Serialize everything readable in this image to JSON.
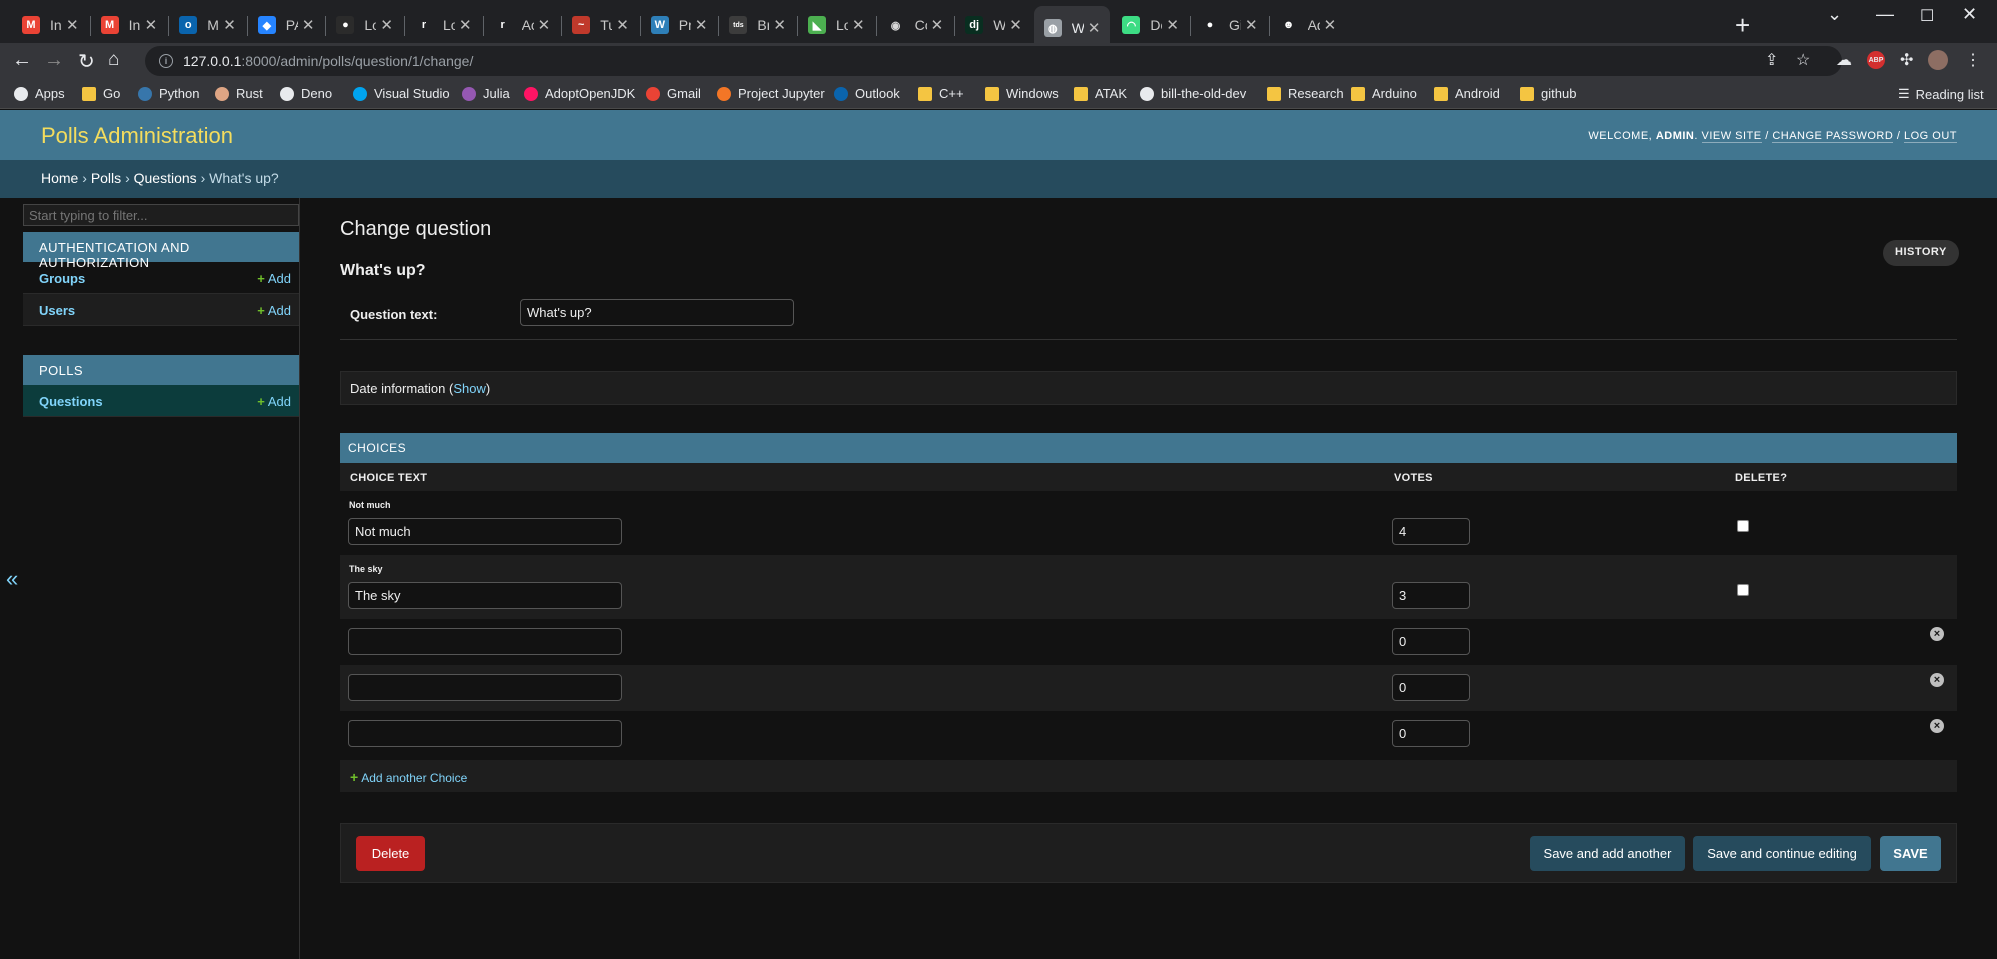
{
  "browser": {
    "tabs": [
      {
        "title": "Inbox",
        "icon": "gmail-icon",
        "color": "#ea4335",
        "glyph": "M"
      },
      {
        "title": "Inbox -",
        "icon": "gmail-icon",
        "color": "#ea4335",
        "glyph": "M"
      },
      {
        "title": "Mail - V",
        "icon": "outlook-icon",
        "color": "#0a64ad",
        "glyph": "o"
      },
      {
        "title": "PAT bo",
        "icon": "jira-icon",
        "color": "#2684ff",
        "glyph": "◆"
      },
      {
        "title": "LoRaW",
        "icon": "github-icon",
        "color": "#2b2b2b",
        "glyph": "●"
      },
      {
        "title": "LoRa",
        "icon": "readthedocs-icon",
        "color": "#ffffff",
        "glyph": "r"
      },
      {
        "title": "Accele",
        "icon": "readthedocs-icon",
        "color": "#ffffff",
        "glyph": "r"
      },
      {
        "title": "Turnin",
        "icon": "turning-icon",
        "color": "#c0392b",
        "glyph": "~"
      },
      {
        "title": "Progra",
        "icon": "wordpress-icon",
        "color": "#2e7fb8",
        "glyph": "W"
      },
      {
        "title": "Bring y",
        "icon": "tds-icon",
        "color": "#3c3c3c",
        "glyph": "tds"
      },
      {
        "title": "Long R",
        "icon": "longr-icon",
        "color": "#4caf50",
        "glyph": "◣"
      },
      {
        "title": "Config",
        "icon": "linux-icon",
        "color": "#d7d7d7",
        "glyph": "◉"
      },
      {
        "title": "Writing",
        "icon": "django-icon",
        "color": "#092e20",
        "glyph": "dj"
      },
      {
        "title": "What's",
        "icon": "globe-icon",
        "color": "#9aa0a6",
        "glyph": "◍",
        "active": true
      },
      {
        "title": "Downl",
        "icon": "android-icon",
        "color": "#3ddc84",
        "glyph": "◠"
      },
      {
        "title": "GitHub",
        "icon": "github-icon",
        "color": "#ffffff",
        "glyph": "●"
      },
      {
        "title": "Add No",
        "icon": "ghost-icon",
        "color": "#ffffff",
        "glyph": "☻"
      }
    ],
    "url_host": "127.0.0.1",
    "url_path": ":8000/admin/polls/question/1/change/",
    "bookmarks": [
      {
        "label": "Apps",
        "icon": "apps-grid-icon"
      },
      {
        "label": "Go",
        "icon": "folder-icon"
      },
      {
        "label": "Python",
        "icon": "python-icon"
      },
      {
        "label": "Rust",
        "icon": "rust-icon"
      },
      {
        "label": "Deno",
        "icon": "deno-icon"
      },
      {
        "label": "Visual Studio",
        "icon": "windows-icon"
      },
      {
        "label": "Julia",
        "icon": "julia-icon"
      },
      {
        "label": "AdoptOpenJDK",
        "icon": "adoptopenjdk-icon"
      },
      {
        "label": "Gmail",
        "icon": "gmail-icon"
      },
      {
        "label": "Project Jupyter",
        "icon": "jupyter-icon"
      },
      {
        "label": "Outlook",
        "icon": "outlook-icon"
      },
      {
        "label": "C++",
        "icon": "folder-icon"
      },
      {
        "label": "Windows",
        "icon": "folder-icon"
      },
      {
        "label": "ATAK",
        "icon": "folder-icon"
      },
      {
        "label": "bill-the-old-dev",
        "icon": "github-icon"
      },
      {
        "label": "Research",
        "icon": "folder-icon"
      },
      {
        "label": "Arduino",
        "icon": "folder-icon"
      },
      {
        "label": "Android",
        "icon": "folder-icon"
      },
      {
        "label": "github",
        "icon": "folder-icon"
      }
    ],
    "reading_list": "Reading list"
  },
  "header": {
    "branding": "Polls Administration",
    "welcome": "WELCOME,",
    "username": "ADMIN",
    "period": ".",
    "view_site": "VIEW SITE",
    "change_password": "CHANGE PASSWORD",
    "log_out": "LOG OUT",
    "sep": "/"
  },
  "breadcrumbs": {
    "home": "Home",
    "app": "Polls",
    "model": "Questions",
    "current": "What's up?",
    "sep": "›"
  },
  "sidebar": {
    "filter_placeholder": "Start typing to filter...",
    "auth_caption": "AUTHENTICATION AND AUTHORIZATION",
    "groups": "Groups",
    "users": "Users",
    "polls_caption": "POLLS",
    "questions": "Questions",
    "add": "Add",
    "collapse": "«"
  },
  "main": {
    "page_title": "Change question",
    "object_title": "What's up?",
    "history": "HISTORY",
    "question_text_label": "Question text:",
    "question_text_value": "What's up?",
    "date_info_label": "Date information (",
    "date_info_show": "Show",
    "date_info_close": ")",
    "choices_caption": "CHOICES",
    "col_choice_text": "CHOICE TEXT",
    "col_votes": "VOTES",
    "col_delete": "DELETE?",
    "choices": [
      {
        "original": "Not much",
        "text": "Not much",
        "votes": "4"
      },
      {
        "original": "The sky",
        "text": "The sky",
        "votes": "3"
      },
      {
        "original": "",
        "text": "",
        "votes": "0"
      },
      {
        "original": "",
        "text": "",
        "votes": "0"
      },
      {
        "original": "",
        "text": "",
        "votes": "0"
      }
    ],
    "add_another": "Add another Choice",
    "delete_button": "Delete",
    "save_add_another": "Save and add another",
    "save_continue": "Save and continue editing",
    "save": "SAVE"
  },
  "colors": {
    "header": "#417690",
    "breadcrumbs": "#264b5d",
    "branding": "#f5dd5d",
    "link": "#81d4fa",
    "delete": "#ba2121",
    "add_plus": "#70bf2b"
  }
}
